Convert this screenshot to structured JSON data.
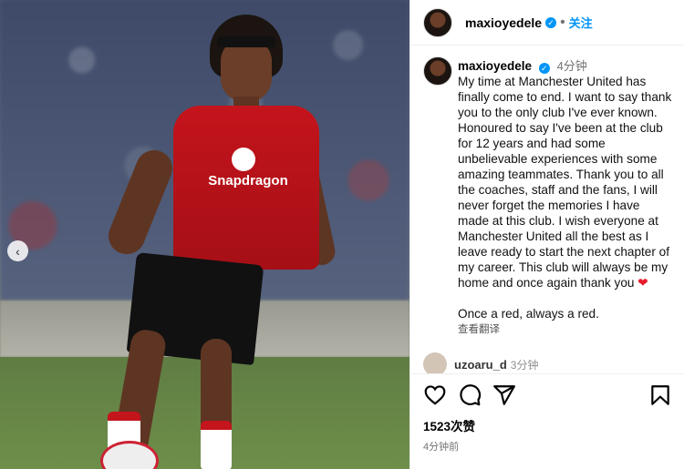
{
  "post": {
    "username": "maxioyedele",
    "follow_label": "关注",
    "dot": "•",
    "verified_symbol": "✓",
    "time_short": "4分钟",
    "caption": "My time at Manchester United has finally come to end. I want to say thank you to the only club I've ever known. Honoured to say I've been at the club for 12 years and had some unbelievable experiences with some amazing teammates. Thank you to all the coaches, staff and the fans, I will never forget the memories I have made at this club. I wish everyone at Manchester United all the best as I leave ready to start the next chapter of my career. This club will always be my home and once again thank you ",
    "heart": "❤",
    "caption_end": "Once a red, always a red.",
    "translate_label": "查看翻译",
    "likes": "1523次赞",
    "posted_time": "4分钟前"
  },
  "next_comment": {
    "username": "uzoaru_d",
    "time": "3分钟"
  },
  "photo": {
    "shirt_sponsor": "Snapdragon",
    "prev_arrow": "‹"
  },
  "icons": [
    "heart-icon",
    "comment-icon",
    "share-icon",
    "bookmark-icon"
  ],
  "colors": {
    "accent": "#0095f6",
    "heart": "#e8192c",
    "kit_red": "#c4141c"
  }
}
